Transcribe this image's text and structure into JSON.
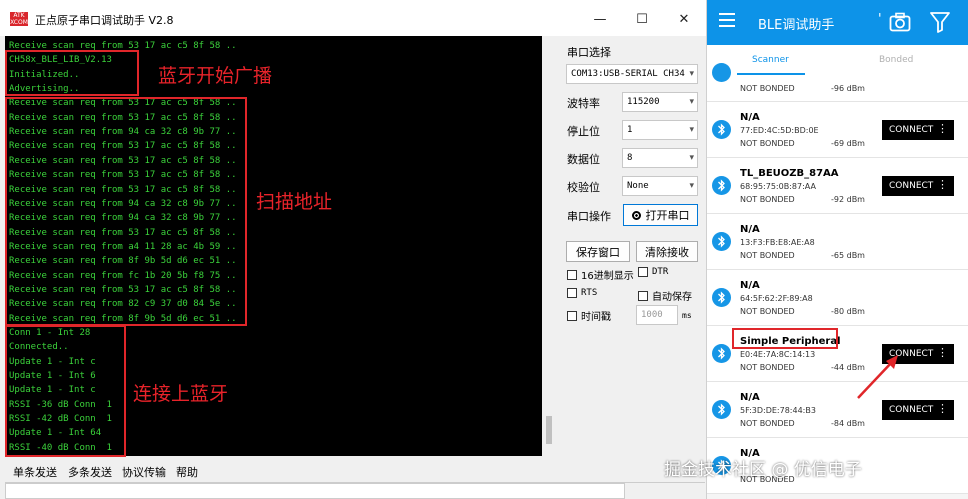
{
  "serial_app": {
    "title": "正点原子串口调试助手 V2.8",
    "logo_text": "ATK XCOM",
    "window_buttons": {
      "minimize": "—",
      "maximize": "☐",
      "close": "✕"
    }
  },
  "terminal": {
    "lines": [
      "Receive scan req from 53 17 ac c5 8f 58 ..",
      "CH58x_BLE_LIB_V2.13",
      "Initialized..",
      "Advertising..",
      "Receive scan req from 53 17 ac c5 8f 58 ..",
      "Receive scan req from 53 17 ac c5 8f 58 ..",
      "Receive scan req from 94 ca 32 c8 9b 77 ..",
      "Receive scan req from 53 17 ac c5 8f 58 ..",
      "Receive scan req from 53 17 ac c5 8f 58 ..",
      "Receive scan req from 53 17 ac c5 8f 58 ..",
      "Receive scan req from 53 17 ac c5 8f 58 ..",
      "Receive scan req from 94 ca 32 c8 9b 77 ..",
      "Receive scan req from 94 ca 32 c8 9b 77 ..",
      "Receive scan req from 53 17 ac c5 8f 58 ..",
      "Receive scan req from a4 11 28 ac 4b 59 ..",
      "Receive scan req from 8f 9b 5d d6 ec 51 ..",
      "Receive scan req from fc 1b 20 5b f8 75 ..",
      "Receive scan req from 53 17 ac c5 8f 58 ..",
      "Receive scan req from 82 c9 37 d0 84 5e ..",
      "Receive scan req from 8f 9b 5d d6 ec 51 ..",
      "Conn 1 - Int 28",
      "Connected..",
      "Update 1 - Int c",
      "Update 1 - Int 6",
      "Update 1 - Int c",
      "RSSI -36 dB Conn  1",
      "RSSI -42 dB Conn  1",
      "Update 1 - Int 64",
      "RSSI -40 dB Conn  1"
    ],
    "annotations": {
      "advertising": "蓝牙开始广播",
      "scanning": "扫描地址",
      "connected": "连接上蓝牙"
    }
  },
  "settings": {
    "port_label": "串口选择",
    "port_value": "COM13:USB-SERIAL CH34",
    "baud_label": "波特率",
    "baud_value": "115200",
    "stop_label": "停止位",
    "stop_value": "1",
    "data_label": "数据位",
    "data_value": "8",
    "parity_label": "校验位",
    "parity_value": "None",
    "op_label": "串口操作",
    "open_button": "打开串口",
    "save_window": "保存窗口",
    "clear_recv": "清除接收",
    "hex_display": "16进制显示",
    "dtr": "DTR",
    "rts": "RTS",
    "auto_save": "自动保存",
    "timestamp": "时间戳",
    "timestamp_ms": "1000",
    "ms_unit": "ms"
  },
  "bottom_tabs": [
    "单条发送",
    "多条发送",
    "协议传输",
    "帮助"
  ],
  "ble_app": {
    "title": "BLE调试助手",
    "apostrophe": "'",
    "tabs": {
      "scanner": "Scanner",
      "bonded": "Bonded"
    },
    "connect_label": "CONNECT",
    "devices": [
      {
        "name": "",
        "mac": "",
        "status": "NOT BONDED",
        "rssi": "-96 dBm",
        "connect": false
      },
      {
        "name": "N/A",
        "mac": "77:ED:4C:5D:BD:0E",
        "status": "NOT BONDED",
        "rssi": "-69 dBm",
        "connect": true
      },
      {
        "name": "TL_BEUOZB_87AA",
        "mac": "68:95:75:0B:87:AA",
        "status": "NOT BONDED",
        "rssi": "-92 dBm",
        "connect": true
      },
      {
        "name": "N/A",
        "mac": "13:F3:FB:E8:AE:A8",
        "status": "NOT BONDED",
        "rssi": "-65 dBm",
        "connect": false
      },
      {
        "name": "N/A",
        "mac": "64:5F:62:2F:89:A8",
        "status": "NOT BONDED",
        "rssi": "-80 dBm",
        "connect": false
      },
      {
        "name": "Simple Peripheral",
        "mac": "E0:4E:7A:8C:14:13",
        "status": "NOT BONDED",
        "rssi": "-44 dBm",
        "connect": true
      },
      {
        "name": "N/A",
        "mac": "5F:3D:DE:78:44:B3",
        "status": "NOT BONDED",
        "rssi": "-84 dBm",
        "connect": true
      },
      {
        "name": "N/A",
        "mac": "",
        "status": "NOT BONDED",
        "rssi": "",
        "connect": false
      }
    ]
  },
  "watermark": "掘金技术社区 @ 优信电子",
  "colors": {
    "terminal_text": "#3bd23b",
    "annotation_red": "#e8232a",
    "ble_blue": "#0d93e8"
  }
}
